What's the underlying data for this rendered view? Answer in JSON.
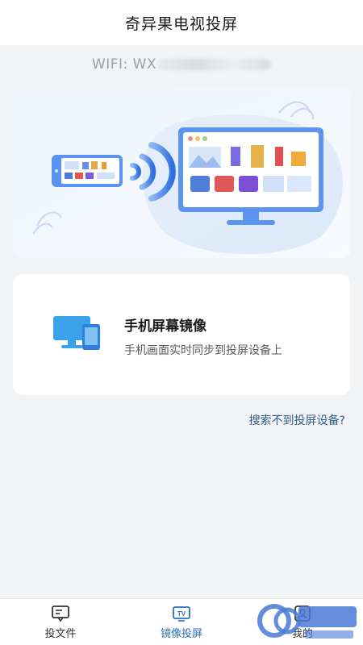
{
  "header": {
    "title": "奇异果电视投屏"
  },
  "wifi": {
    "label": "WIFI: WX"
  },
  "mirror_card": {
    "title": "手机屏幕镜像",
    "subtitle": "手机画面实时同步到投屏设备上"
  },
  "help_link": {
    "label": "搜索不到投屏设备?"
  },
  "tabbar": {
    "tabs": [
      {
        "label": "投文件",
        "icon": "file-cast-icon",
        "active": false
      },
      {
        "label": "镜像投屏",
        "icon": "tv-mirror-icon",
        "active": true
      },
      {
        "label": "我的",
        "icon": "profile-icon",
        "active": false
      }
    ]
  },
  "colors": {
    "accent": "#2b6fb3",
    "link": "#2c5e8a",
    "background": "#f2f3f5"
  }
}
